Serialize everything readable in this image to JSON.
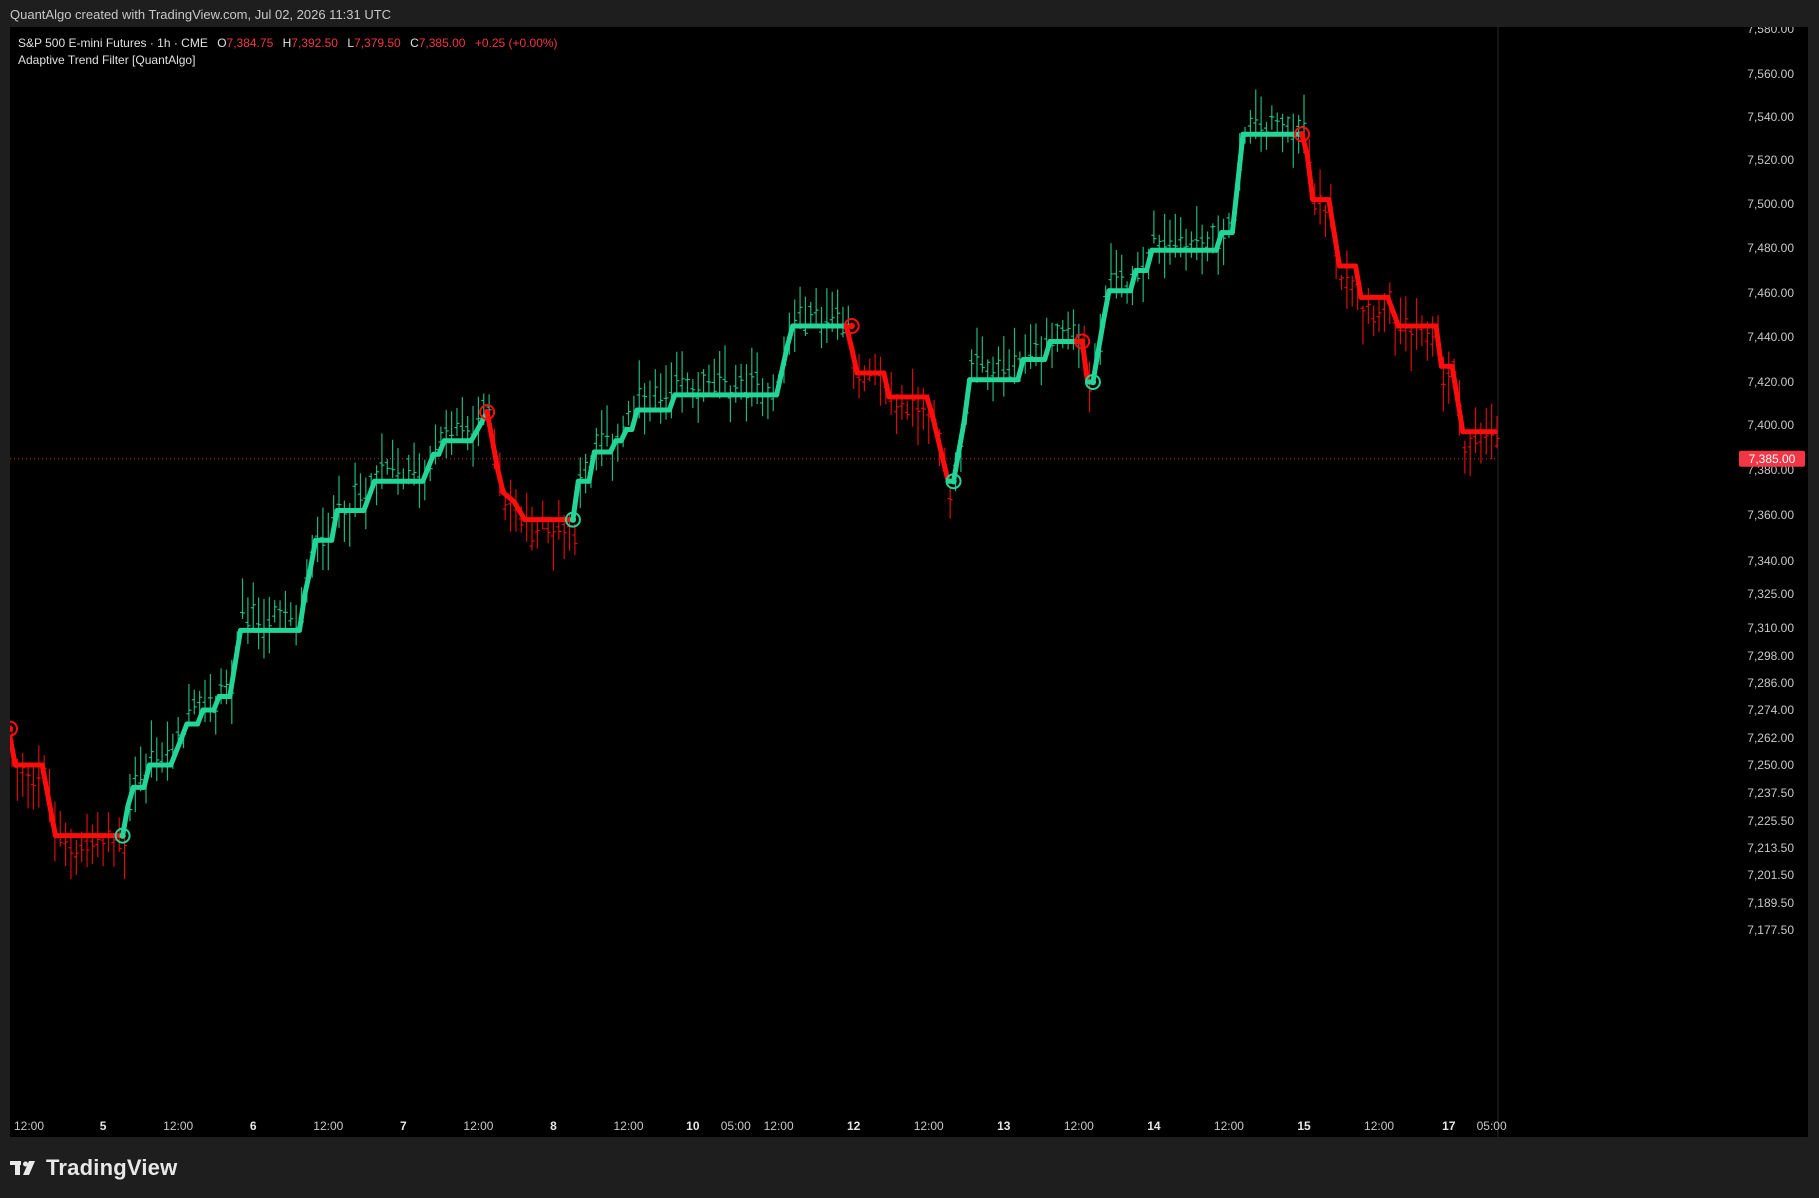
{
  "header": {
    "credit": "QuantAlgo created with TradingView.com, Jul 02, 2026 11:31 UTC"
  },
  "legend": {
    "symbol": "S&P 500 E-mini Futures · 1h · CME",
    "open_label": "O",
    "open": "7,384.75",
    "high_label": "H",
    "high": "7,392.50",
    "low_label": "L",
    "low": "7,379.50",
    "close_label": "C",
    "close": "7,385.00",
    "change": "+0.25 (+0.00%)",
    "indicator": "Adaptive Trend Filter [QuantAlgo]"
  },
  "current_price": {
    "label": "7,385.00",
    "value": 7385
  },
  "footer": {
    "brand": "TradingView",
    "logo_icon": "tradingview-logo-icon"
  },
  "colors": {
    "bullish": "#22d69a",
    "bearish": "#ff0d0d",
    "background": "#000000",
    "frame": "#1e1e1e",
    "price_tag": "#f23645"
  },
  "chart_data": {
    "type": "line",
    "symbol": "S&P 500 E-mini Futures",
    "timeframe": "1h",
    "y_axis": {
      "ticks": [
        {
          "value": 7580,
          "label": "7,580.00"
        },
        {
          "value": 7560,
          "label": "7,560.00"
        },
        {
          "value": 7540,
          "label": "7,540.00"
        },
        {
          "value": 7520,
          "label": "7,520.00"
        },
        {
          "value": 7500,
          "label": "7,500.00"
        },
        {
          "value": 7480,
          "label": "7,480.00"
        },
        {
          "value": 7460,
          "label": "7,460.00"
        },
        {
          "value": 7440,
          "label": "7,440.00"
        },
        {
          "value": 7420,
          "label": "7,420.00"
        },
        {
          "value": 7400,
          "label": "7,400.00"
        },
        {
          "value": 7380,
          "label": "7,380.00"
        },
        {
          "value": 7360,
          "label": "7,360.00"
        },
        {
          "value": 7340,
          "label": "7,340.00"
        },
        {
          "value": 7325,
          "label": "7,325.00"
        },
        {
          "value": 7310,
          "label": "7,310.00"
        },
        {
          "value": 7298,
          "label": "7,298.00"
        },
        {
          "value": 7286,
          "label": "7,286.00"
        },
        {
          "value": 7274,
          "label": "7,274.00"
        },
        {
          "value": 7262,
          "label": "7,262.00"
        },
        {
          "value": 7250,
          "label": "7,250.00"
        },
        {
          "value": 7237.5,
          "label": "7,237.50"
        },
        {
          "value": 7225.5,
          "label": "7,225.50"
        },
        {
          "value": 7213.5,
          "label": "7,213.50"
        },
        {
          "value": 7201.5,
          "label": "7,201.50"
        },
        {
          "value": 7189.5,
          "label": "7,189.50"
        },
        {
          "value": 7177.5,
          "label": "7,177.50"
        }
      ]
    },
    "x_axis": {
      "range": [
        0,
        250
      ],
      "ticks": [
        {
          "t": 2,
          "label": "12:00",
          "bold": false
        },
        {
          "t": 17,
          "label": "5",
          "bold": true
        },
        {
          "t": 31,
          "label": "12:00",
          "bold": false
        },
        {
          "t": 45,
          "label": "6",
          "bold": true
        },
        {
          "t": 59,
          "label": "12:00",
          "bold": false
        },
        {
          "t": 73,
          "label": "7",
          "bold": true
        },
        {
          "t": 87,
          "label": "12:00",
          "bold": false
        },
        {
          "t": 101,
          "label": "8",
          "bold": true
        },
        {
          "t": 115,
          "label": "12:00",
          "bold": false
        },
        {
          "t": 127,
          "label": "10",
          "bold": true
        },
        {
          "t": 135,
          "label": "05:00",
          "bold": false
        },
        {
          "t": 143,
          "label": "12:00",
          "bold": false
        },
        {
          "t": 157,
          "label": "12",
          "bold": true
        },
        {
          "t": 171,
          "label": "12:00",
          "bold": false
        },
        {
          "t": 185,
          "label": "13",
          "bold": true
        },
        {
          "t": 199,
          "label": "12:00",
          "bold": false
        },
        {
          "t": 213,
          "label": "14",
          "bold": true
        },
        {
          "t": 227,
          "label": "12:00",
          "bold": false
        },
        {
          "t": 241,
          "label": "15",
          "bold": true
        },
        {
          "t": 255,
          "label": "12:00",
          "bold": false
        },
        {
          "t": 268,
          "label": "17",
          "bold": true
        },
        {
          "t": 276,
          "label": "05:00",
          "bold": false
        }
      ]
    },
    "trend_line": [
      {
        "t": 0,
        "v": 7262,
        "dir": "down"
      },
      {
        "t": 1,
        "v": 7250,
        "dir": "down"
      },
      {
        "t": 6,
        "v": 7250,
        "dir": "down"
      },
      {
        "t": 8,
        "v": 7225,
        "dir": "down"
      },
      {
        "t": 8.5,
        "v": 7219,
        "dir": "down"
      },
      {
        "t": 21,
        "v": 7219,
        "dir": "down"
      },
      {
        "t": 22,
        "v": 7232,
        "dir": "up"
      },
      {
        "t": 23,
        "v": 7240,
        "dir": "up"
      },
      {
        "t": 25,
        "v": 7240,
        "dir": "up"
      },
      {
        "t": 26,
        "v": 7250,
        "dir": "up"
      },
      {
        "t": 30,
        "v": 7250,
        "dir": "up"
      },
      {
        "t": 32,
        "v": 7262,
        "dir": "up"
      },
      {
        "t": 33,
        "v": 7268,
        "dir": "up"
      },
      {
        "t": 35,
        "v": 7268,
        "dir": "up"
      },
      {
        "t": 36,
        "v": 7274,
        "dir": "up"
      },
      {
        "t": 38,
        "v": 7274,
        "dir": "up"
      },
      {
        "t": 39,
        "v": 7280,
        "dir": "up"
      },
      {
        "t": 41,
        "v": 7280,
        "dir": "up"
      },
      {
        "t": 43,
        "v": 7309,
        "dir": "up"
      },
      {
        "t": 54,
        "v": 7309,
        "dir": "up"
      },
      {
        "t": 55,
        "v": 7325,
        "dir": "up"
      },
      {
        "t": 56,
        "v": 7336,
        "dir": "up"
      },
      {
        "t": 57,
        "v": 7349,
        "dir": "up"
      },
      {
        "t": 60,
        "v": 7349,
        "dir": "up"
      },
      {
        "t": 61,
        "v": 7362,
        "dir": "up"
      },
      {
        "t": 66,
        "v": 7362,
        "dir": "up"
      },
      {
        "t": 68,
        "v": 7375,
        "dir": "up"
      },
      {
        "t": 77,
        "v": 7375,
        "dir": "up"
      },
      {
        "t": 79,
        "v": 7387,
        "dir": "up"
      },
      {
        "t": 80,
        "v": 7387,
        "dir": "up"
      },
      {
        "t": 81,
        "v": 7393,
        "dir": "up"
      },
      {
        "t": 86,
        "v": 7393,
        "dir": "up"
      },
      {
        "t": 87,
        "v": 7397,
        "dir": "up"
      },
      {
        "t": 89,
        "v": 7406,
        "dir": "up"
      },
      {
        "t": 91,
        "v": 7380,
        "dir": "down"
      },
      {
        "t": 92,
        "v": 7370,
        "dir": "down"
      },
      {
        "t": 94,
        "v": 7366,
        "dir": "down"
      },
      {
        "t": 96,
        "v": 7358,
        "dir": "down"
      },
      {
        "t": 105,
        "v": 7358,
        "dir": "down"
      },
      {
        "t": 106,
        "v": 7375,
        "dir": "up"
      },
      {
        "t": 108,
        "v": 7375,
        "dir": "up"
      },
      {
        "t": 109,
        "v": 7388,
        "dir": "up"
      },
      {
        "t": 112,
        "v": 7388,
        "dir": "up"
      },
      {
        "t": 113,
        "v": 7393,
        "dir": "up"
      },
      {
        "t": 114,
        "v": 7393,
        "dir": "up"
      },
      {
        "t": 115,
        "v": 7398,
        "dir": "up"
      },
      {
        "t": 116,
        "v": 7398,
        "dir": "up"
      },
      {
        "t": 117,
        "v": 7407,
        "dir": "up"
      },
      {
        "t": 123,
        "v": 7407,
        "dir": "up"
      },
      {
        "t": 124,
        "v": 7414,
        "dir": "up"
      },
      {
        "t": 143,
        "v": 7414,
        "dir": "up"
      },
      {
        "t": 145,
        "v": 7436,
        "dir": "up"
      },
      {
        "t": 146,
        "v": 7445,
        "dir": "up"
      },
      {
        "t": 156,
        "v": 7445,
        "dir": "up"
      },
      {
        "t": 157,
        "v": 7435,
        "dir": "down"
      },
      {
        "t": 158,
        "v": 7424,
        "dir": "down"
      },
      {
        "t": 163,
        "v": 7424,
        "dir": "down"
      },
      {
        "t": 164,
        "v": 7413,
        "dir": "down"
      },
      {
        "t": 171,
        "v": 7413,
        "dir": "down"
      },
      {
        "t": 172,
        "v": 7405,
        "dir": "down"
      },
      {
        "t": 175,
        "v": 7375,
        "dir": "down"
      },
      {
        "t": 176,
        "v": 7375,
        "dir": "up"
      },
      {
        "t": 178,
        "v": 7402,
        "dir": "up"
      },
      {
        "t": 179,
        "v": 7421,
        "dir": "up"
      },
      {
        "t": 188,
        "v": 7421,
        "dir": "up"
      },
      {
        "t": 189,
        "v": 7430,
        "dir": "up"
      },
      {
        "t": 193,
        "v": 7430,
        "dir": "up"
      },
      {
        "t": 194,
        "v": 7438,
        "dir": "up"
      },
      {
        "t": 199,
        "v": 7438,
        "dir": "up"
      },
      {
        "t": 200,
        "v": 7438,
        "dir": "down"
      },
      {
        "t": 201,
        "v": 7420,
        "dir": "down"
      },
      {
        "t": 202,
        "v": 7420,
        "dir": "up"
      },
      {
        "t": 204,
        "v": 7448,
        "dir": "up"
      },
      {
        "t": 205,
        "v": 7461,
        "dir": "up"
      },
      {
        "t": 209,
        "v": 7461,
        "dir": "up"
      },
      {
        "t": 210,
        "v": 7470,
        "dir": "up"
      },
      {
        "t": 212,
        "v": 7470,
        "dir": "up"
      },
      {
        "t": 213,
        "v": 7479,
        "dir": "up"
      },
      {
        "t": 225,
        "v": 7479,
        "dir": "up"
      },
      {
        "t": 226,
        "v": 7487,
        "dir": "up"
      },
      {
        "t": 228,
        "v": 7487,
        "dir": "up"
      },
      {
        "t": 230,
        "v": 7532,
        "dir": "up"
      },
      {
        "t": 241,
        "v": 7532,
        "dir": "up"
      },
      {
        "t": 242,
        "v": 7522,
        "dir": "down"
      },
      {
        "t": 243,
        "v": 7502,
        "dir": "down"
      },
      {
        "t": 246,
        "v": 7502,
        "dir": "down"
      },
      {
        "t": 248,
        "v": 7472,
        "dir": "down"
      },
      {
        "t": 251,
        "v": 7472,
        "dir": "down"
      },
      {
        "t": 252,
        "v": 7458,
        "dir": "down"
      },
      {
        "t": 257,
        "v": 7458,
        "dir": "down"
      },
      {
        "t": 259,
        "v": 7445,
        "dir": "down"
      },
      {
        "t": 266,
        "v": 7445,
        "dir": "down"
      },
      {
        "t": 267,
        "v": 7427,
        "dir": "down"
      },
      {
        "t": 269,
        "v": 7427,
        "dir": "down"
      },
      {
        "t": 271,
        "v": 7397,
        "dir": "down"
      },
      {
        "t": 277,
        "v": 7397,
        "dir": "down"
      }
    ],
    "signals": [
      {
        "t": 0,
        "v": 7266,
        "type": "bearish"
      },
      {
        "t": 21,
        "v": 7219,
        "type": "bullish"
      },
      {
        "t": 89,
        "v": 7406,
        "type": "bearish"
      },
      {
        "t": 105,
        "v": 7358,
        "type": "bullish"
      },
      {
        "t": 157,
        "v": 7445,
        "type": "bearish"
      },
      {
        "t": 176,
        "v": 7375,
        "type": "bullish"
      },
      {
        "t": 200,
        "v": 7438,
        "type": "bearish"
      },
      {
        "t": 202,
        "v": 7420,
        "type": "bullish"
      },
      {
        "t": 241,
        "v": 7532,
        "type": "bearish"
      }
    ]
  }
}
